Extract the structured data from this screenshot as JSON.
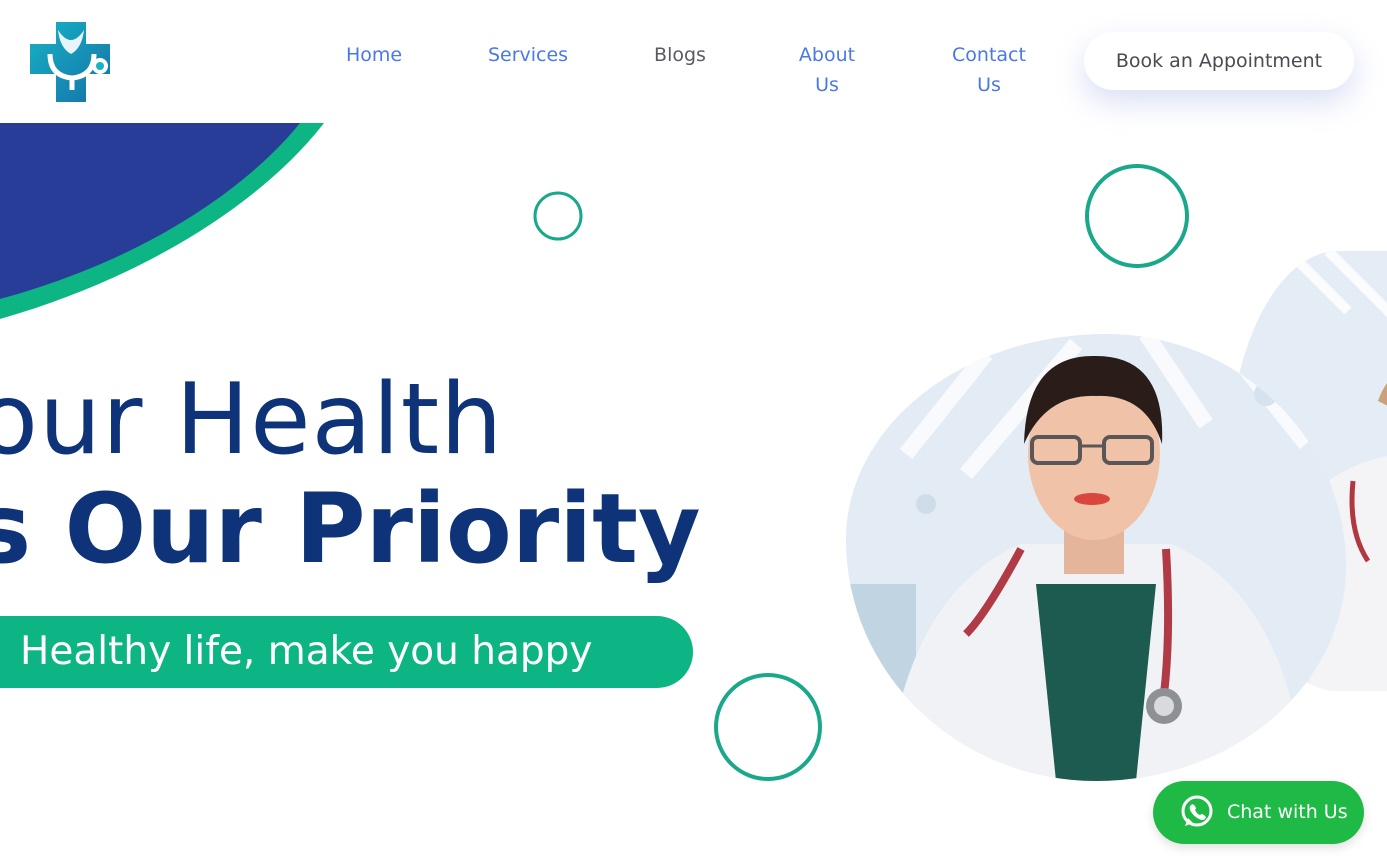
{
  "nav": {
    "items": [
      {
        "label": "Home"
      },
      {
        "label": "Services"
      },
      {
        "label": "Blogs"
      },
      {
        "label": "About Us"
      },
      {
        "label": "Contact Us"
      }
    ],
    "cta_label": "Book an Appointment"
  },
  "hero": {
    "headline_line1": "our Health",
    "headline_line2": "s Our Priority",
    "tagline": "Healthy life, make you happy"
  },
  "chat": {
    "label": "Chat with Us",
    "icon": "whatsapp-icon"
  },
  "colors": {
    "brand_navy": "#0e3378",
    "accent_green": "#0db585",
    "link_blue": "#4b78e8",
    "whatsapp_green": "#1fba45",
    "blob_blue": "#283d97"
  }
}
